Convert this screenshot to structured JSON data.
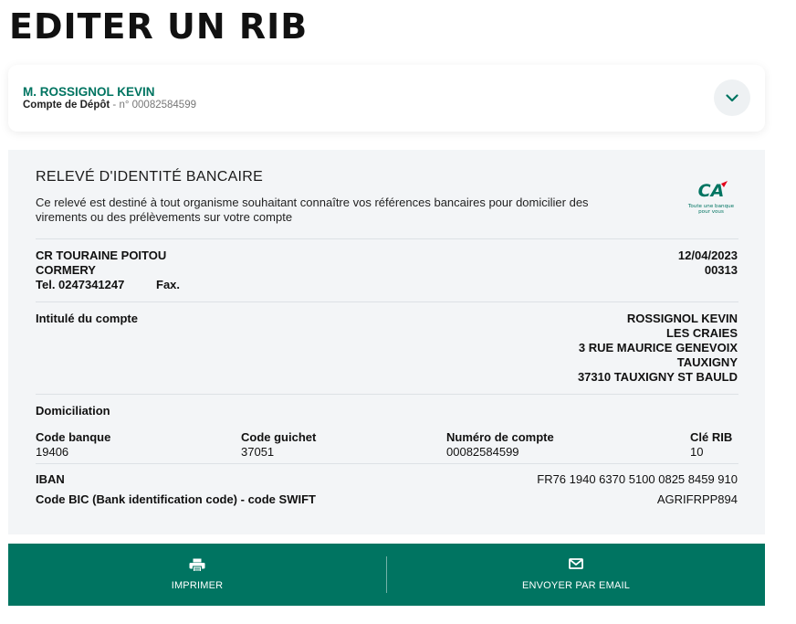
{
  "page": {
    "title": "EDITER UN RIB"
  },
  "account": {
    "holder": "M. ROSSIGNOL KEVIN",
    "type": "Compte de Dépôt",
    "separator": " - ",
    "number_label": "n° 00082584599"
  },
  "rib": {
    "title": "RELEVÉ D'IDENTITÉ BANCAIRE",
    "description": "Ce relevé est destiné à tout organisme souhaitant connaître vos références bancaires pour domicilier des virements ou des prélèvements sur votre compte",
    "logo": {
      "mark": "CA",
      "tagline_1": "Toute une banque",
      "tagline_2": "pour vous"
    },
    "agency": {
      "name": "CR TOURAINE POITOU",
      "city": "CORMERY",
      "tel_label": "Tel. 0247341247",
      "fax_label": "Fax.",
      "date": "12/04/2023",
      "agency_code": "00313"
    },
    "account_holder": {
      "label": "Intitulé du compte",
      "lines": [
        "ROSSIGNOL KEVIN",
        "LES CRAIES",
        "3 RUE MAURICE GENEVOIX",
        "TAUXIGNY",
        "37310 TAUXIGNY ST BAULD"
      ]
    },
    "domiciliation_label": "Domiciliation",
    "codes": {
      "bank_label": "Code banque",
      "bank": "19406",
      "branch_label": "Code guichet",
      "branch": "37051",
      "account_label": "Numéro de compte",
      "account": "00082584599",
      "key_label": "Clé RIB",
      "key": "10"
    },
    "iban_label": "IBAN",
    "iban": "FR76 1940 6370 5100 0825 8459 910",
    "bic_label": "Code BIC (Bank identification code) - code SWIFT",
    "bic": "AGRIFRPP894"
  },
  "actions": {
    "print": "IMPRIMER",
    "email": "ENVOYER PAR EMAIL"
  },
  "colors": {
    "brand_green": "#007461",
    "panel_bg": "#f3f5f7",
    "logo_red": "#e2001a"
  },
  "icons": {
    "dropdown": "chevron-down-icon",
    "print": "printer-icon",
    "email": "envelope-icon"
  }
}
